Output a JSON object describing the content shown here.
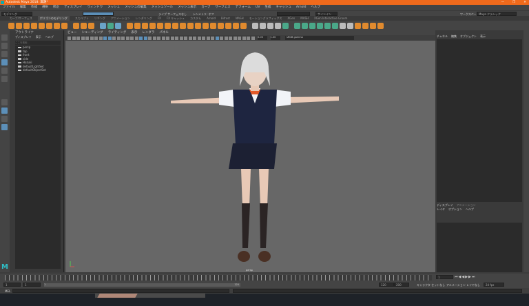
{
  "window": {
    "title": "Autodesk Maya 2018: 無題*",
    "controls": [
      "—",
      "❐",
      "✕"
    ]
  },
  "menubar": [
    "ファイル",
    "編集",
    "作成",
    "選択",
    "修正",
    "ディスプレイ",
    "ウィンドウ",
    "メッシュ",
    "メッシュの編集",
    "メッシュツール",
    "メッシュ表示",
    "カーブ",
    "サーフェス",
    "デフォーム",
    "UV",
    "生成",
    "キャッシュ",
    "Arnold",
    "ヘルプ"
  ],
  "statusline": {
    "menuset": "モデリング",
    "live": "ライブ サーフェスなし",
    "symmetry": "シンメトリ: オフ",
    "signin": "サインイン",
    "workspace_label": "ワークスペース :",
    "workspace": "Maya クラシック"
  },
  "shelf": {
    "tabs": [
      "カーブ/サーフェス",
      "ポリゴンのモデリング",
      "スカルプト",
      "リギング",
      "アニメーション",
      "レンダリング",
      "FX",
      "FX キャッシュ",
      "カスタム",
      "Arnold",
      "Bifrost",
      "MASH",
      "モーショングラフィックス",
      "XGen",
      "MASH",
      "XGen Interactive Groom"
    ],
    "active": 1
  },
  "outliner": {
    "title": "アウトライナ",
    "menu": [
      "ディスプレイ",
      "表示",
      "ヘルプ"
    ],
    "search_placeholder": "ここを検索...",
    "items": [
      "persp",
      "top",
      "front",
      "side",
      "Hozuki",
      "defaultLightSet",
      "defaultObjectSet"
    ]
  },
  "viewport": {
    "menu": [
      "ビュー",
      "シェーディング",
      "ライティング",
      "表示",
      "レンダラ",
      "パネル"
    ],
    "near": "0.00",
    "far": "1.00",
    "colorspace": "sRGB gamma",
    "camera": "persp"
  },
  "channelbox": {
    "tabs": [
      "チャネル",
      "編集",
      "オブジェクト",
      "表示"
    ]
  },
  "layereditor": {
    "tabs": [
      "ディスプレイ",
      "アニメーション"
    ],
    "menu": [
      "レイヤ",
      "オプション",
      "ヘルプ"
    ]
  },
  "timeslider": {
    "current": "1"
  },
  "range": {
    "start": "1",
    "inner_start": "1",
    "inner_end": "120",
    "end": "120",
    "outer_end": "200",
    "character_set": "キャラクタ セットなし",
    "anim_layer": "アニメーション レイヤなし",
    "fps": "24 fps"
  },
  "cmdline": {
    "label": "MEL"
  },
  "colors": {
    "title": "#f06a1c",
    "accent": "#5c8fb8",
    "shelf_icon": "#e08a2e"
  }
}
